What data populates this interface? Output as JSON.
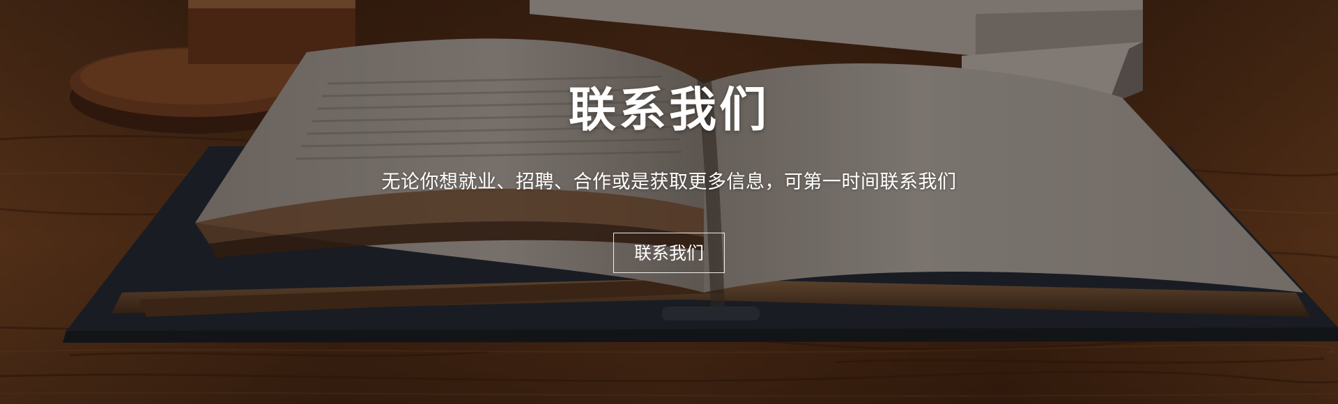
{
  "banner": {
    "title": "联系我们",
    "subtitle": "无论你想就业、招聘、合作或是获取更多信息，可第一时间联系我们",
    "cta_label": "联系我们"
  },
  "colors": {
    "text": "#ffffff",
    "button_border": "#ffffff",
    "wood": "#5a321a",
    "page": "#a39c97",
    "book_cover": "#1f2630"
  },
  "background": {
    "description_icon": "open-book-on-wooden-table-image"
  }
}
